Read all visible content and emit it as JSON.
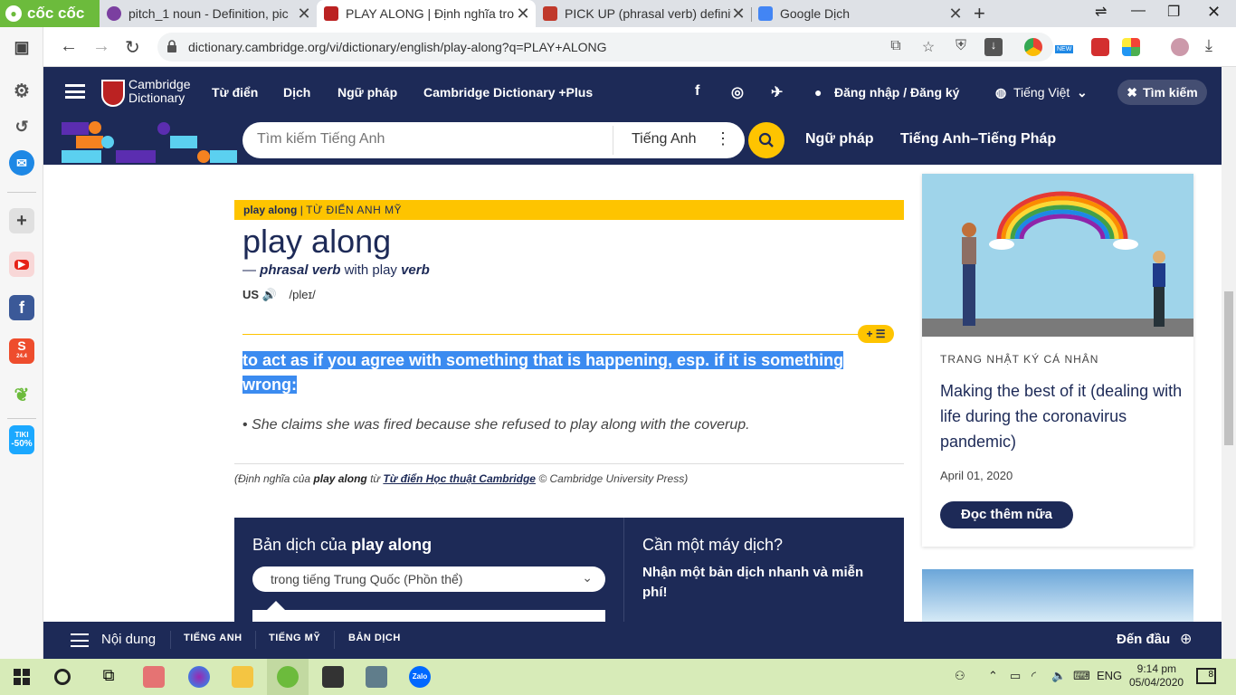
{
  "browser": {
    "brand": "cốc cốc",
    "tabs": [
      {
        "title": "pitch_1 noun - Definition, pic"
      },
      {
        "title": "PLAY ALONG | Định nghĩa tro"
      },
      {
        "title": "PICK UP (phrasal verb) definiti"
      },
      {
        "title": "Google Dịch"
      }
    ],
    "url": "dictionary.cambridge.org/vi/dictionary/english/play-along?q=PLAY+ALONG",
    "ext_badge": "NEW"
  },
  "sidebar": {
    "shopee_label": "24.4",
    "tiki_label": "TIKI",
    "tiki_badge": "-50%"
  },
  "header": {
    "logo_line1": "Cambridge",
    "logo_line2": "Dictionary",
    "nav": [
      "Từ điển",
      "Dịch",
      "Ngữ pháp",
      "Cambridge Dictionary +Plus"
    ],
    "login": "Đăng nhập / Đăng ký",
    "language": "Tiếng Việt",
    "search_button": "Tìm kiếm"
  },
  "search": {
    "placeholder": "Tìm kiếm Tiếng Anh",
    "lang": "Tiếng Anh",
    "links": [
      "Ngữ pháp",
      "Tiếng Anh–Tiếng Pháp"
    ]
  },
  "entry": {
    "bar_word": "play along",
    "bar_dict": "TỪ ĐIỂN ANH MỸ",
    "headword": "play along",
    "pos_dash": "—",
    "pos": "phrasal verb",
    "pos_with": "with play",
    "pos_verb": "verb",
    "region": "US",
    "ipa": "/pleɪ/",
    "badge": "+ ☰",
    "definition": "to act as if you agree with something that is happening, esp. if it is something wrong:",
    "example": "She claims she was fired because she refused to play along with the coverup.",
    "source_prefix": "(Định nghĩa của",
    "source_word": "play along",
    "source_mid": "từ",
    "source_link": "Từ điển Học thuật Cambridge",
    "source_suffix": "© Cambridge University Press)"
  },
  "translation": {
    "title_prefix": "Bản dịch của",
    "title_word": "play along",
    "select_value": "trong tiếng Trung Quốc (Phồn thể)",
    "machine_title": "Cần một máy dịch?",
    "machine_desc": "Nhận một bản dịch nhanh và miễn phí!"
  },
  "side_card": {
    "kicker": "TRANG NHẬT KÝ CÁ NHÂN",
    "title": "Making the best of it (dealing with life during the coronavirus pandemic)",
    "date": "April 01, 2020",
    "button": "Đọc thêm nữa"
  },
  "bottom_bar": {
    "menu": "Nội dung",
    "items": [
      "TIẾNG ANH",
      "TIẾNG MỸ",
      "BẢN DỊCH"
    ],
    "top": "Đến đầu"
  },
  "taskbar": {
    "zalo": "Zalo",
    "lang": "ENG",
    "time": "9:14 pm",
    "date": "05/04/2020",
    "notif": "8"
  },
  "colors": {
    "cambridge_navy": "#1d2a57",
    "cambridge_yellow": "#fec400",
    "selection_blue": "#3b8bf0",
    "coccoc_green": "#6cbb3c"
  }
}
